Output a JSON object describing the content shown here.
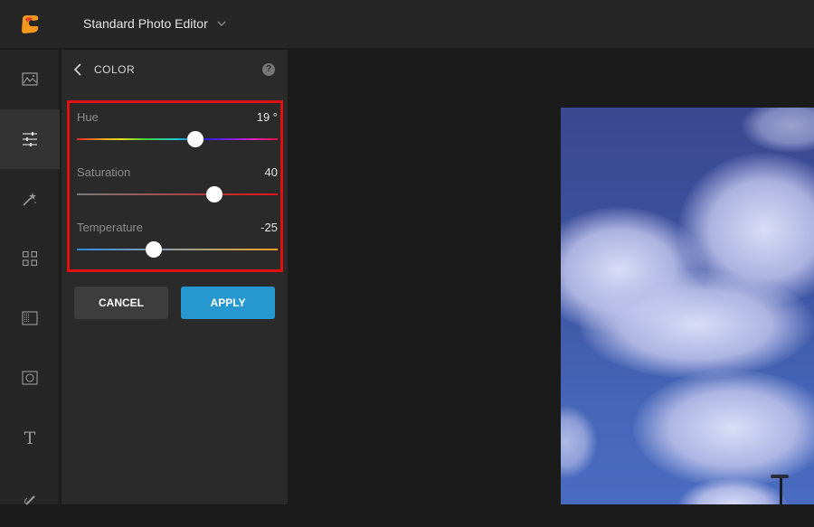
{
  "app": {
    "title": "Standard Photo Editor",
    "logo_icon": "app-logo-icon",
    "title_dropdown_icon": "chevron-down-icon"
  },
  "tools": [
    {
      "name": "image",
      "icon": "image-icon",
      "active": false
    },
    {
      "name": "adjust",
      "icon": "sliders-icon",
      "active": true
    },
    {
      "name": "effects",
      "icon": "magic-wand-icon",
      "active": false
    },
    {
      "name": "collage",
      "icon": "grid-icon",
      "active": false
    },
    {
      "name": "frames",
      "icon": "texture-icon",
      "active": false
    },
    {
      "name": "vignette",
      "icon": "focus-icon",
      "active": false
    },
    {
      "name": "text",
      "icon": "text-icon",
      "active": false
    },
    {
      "name": "draw",
      "icon": "brush-icon",
      "active": false
    }
  ],
  "panel": {
    "title": "COLOR",
    "back_icon": "chevron-left-icon",
    "help_label": "?",
    "sliders": [
      {
        "label": "Hue",
        "value_text": "19 °",
        "value": 19,
        "min": -180,
        "max": 180,
        "fraction": 0.59
      },
      {
        "label": "Saturation",
        "value_text": "40",
        "value": 40,
        "min": -100,
        "max": 100,
        "fraction": 0.685
      },
      {
        "label": "Temperature",
        "value_text": "-25",
        "value": -25,
        "min": -100,
        "max": 100,
        "fraction": 0.385
      }
    ],
    "cancel_label": "CANCEL",
    "apply_label": "APPLY"
  },
  "colors": {
    "accent": "#2798cf",
    "highlight_border": "#e01010",
    "cancel_bg": "#3d3d3d"
  }
}
